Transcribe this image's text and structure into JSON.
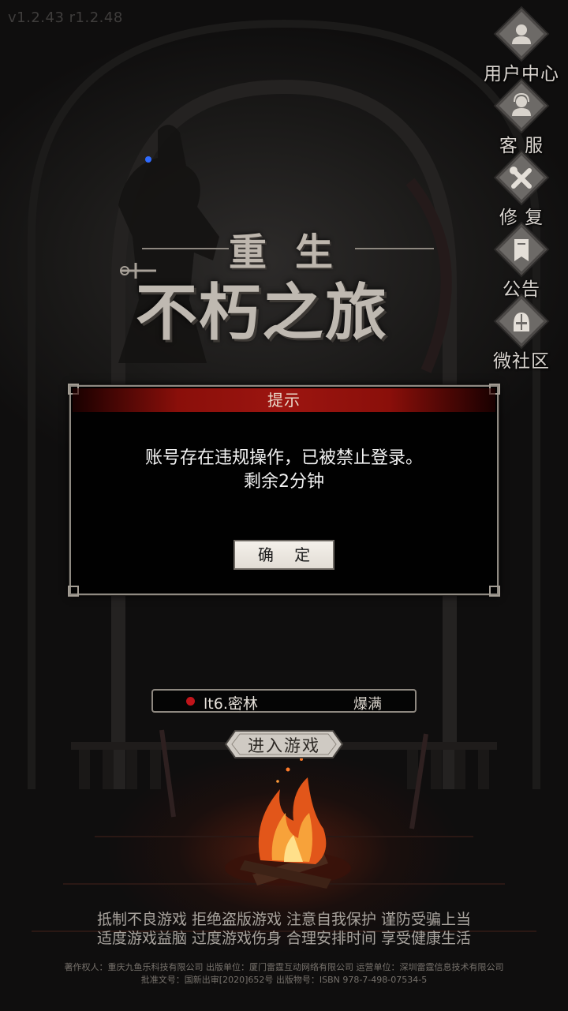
{
  "version": "v1.2.43 r1.2.48",
  "side_menu": [
    {
      "label": "用户中心",
      "icon": "user-icon"
    },
    {
      "label": "客 服",
      "icon": "customer-service-icon"
    },
    {
      "label": "修 复",
      "icon": "repair-tools-icon"
    },
    {
      "label": "公告",
      "icon": "announcement-banner-icon"
    },
    {
      "label": "微社区",
      "icon": "community-helmet-icon"
    }
  ],
  "logo": {
    "subtitle": "重生",
    "title": "不朽之旅"
  },
  "dialog": {
    "title": "提示",
    "message_line1": "账号存在违规操作，已被禁止登录。",
    "message_line2": "剩余2分钟",
    "confirm_label": "确 定"
  },
  "server": {
    "name": "lt6.密林",
    "status": "爆满",
    "status_color": "#c0141a"
  },
  "enter_label": "进入游戏",
  "notice": {
    "line1": "抵制不良游戏 拒绝盗版游戏 注意自我保护 谨防受骗上当",
    "line2": "适度游戏益脑 过度游戏伤身 合理安排时间 享受健康生活"
  },
  "footer": {
    "line1": "著作权人：重庆九鱼乐科技有限公司 出版单位：厦门雷霆互动网络有限公司 运营单位：深圳雷霆信息技术有限公司",
    "line2": "批准文号：国新出审[2020]652号 出版物号：ISBN 978-7-498-07534-5"
  },
  "colors": {
    "title_bar": "#9c1510",
    "dialog_border": "#8f8a82",
    "fire": "#f06a1c"
  }
}
